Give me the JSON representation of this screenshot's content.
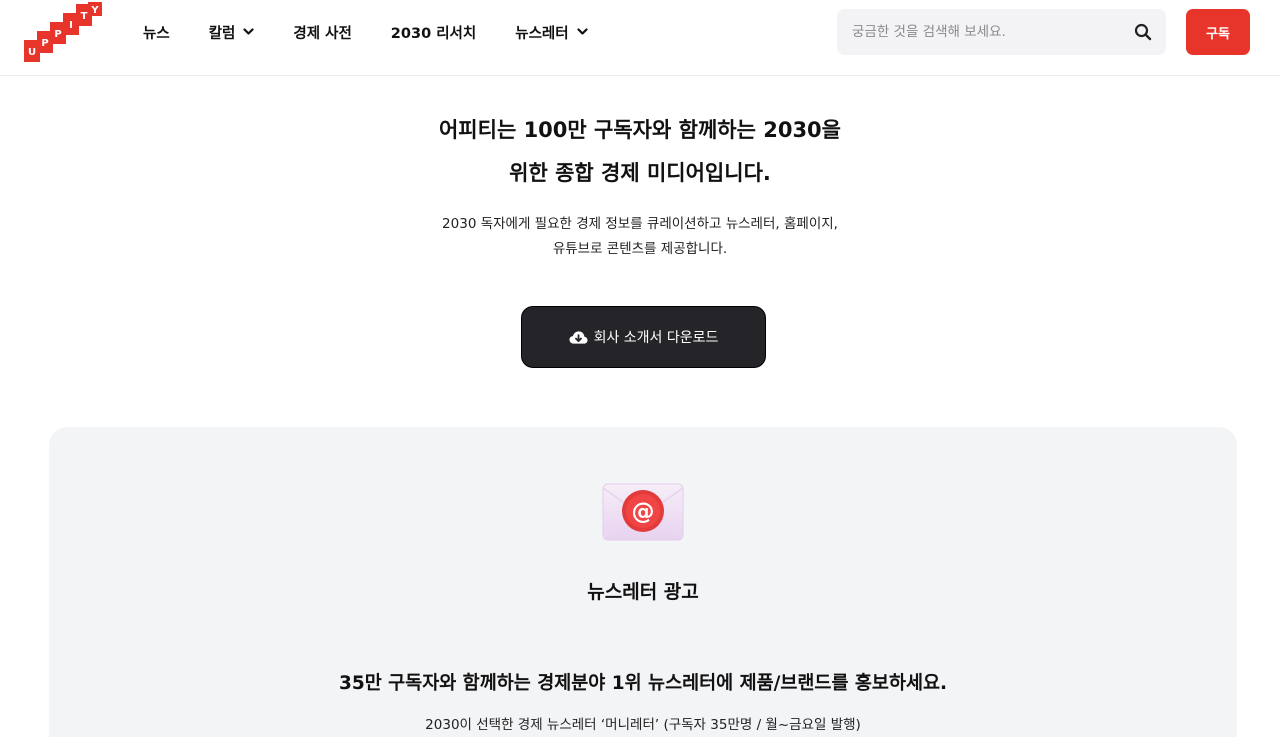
{
  "logo": {
    "text": "UPPITY",
    "letters": [
      "U",
      "P",
      "P",
      "I",
      "T",
      "Y"
    ]
  },
  "nav": {
    "items": [
      {
        "label": "뉴스",
        "has_dropdown": false
      },
      {
        "label": "칼럼",
        "has_dropdown": true
      },
      {
        "label": "경제 사전",
        "has_dropdown": false
      },
      {
        "label": "2030 리서치",
        "has_dropdown": false
      },
      {
        "label": "뉴스레터",
        "has_dropdown": true
      }
    ]
  },
  "search": {
    "placeholder": "궁금한 것을 검색해 보세요.",
    "value": "",
    "icon": "search-icon"
  },
  "header": {
    "subscribe_label": "구독"
  },
  "hero": {
    "title_line1": "어피티는 100만 구독자와 함께하는 2030을",
    "title_line2": "위한 종합 경제 미디어입니다.",
    "desc_line1": "2030 독자에게 필요한 경제 정보를 큐레이션하고 뉴스레터, 홈페이지,",
    "desc_line2": "유튜브로 콘텐츠를 제공합니다.",
    "download_label": "회사 소개서 다운로드",
    "download_icon": "cloud-download-icon"
  },
  "newsletter_ad": {
    "icon": "mail-at-icon",
    "title": "뉴스레터 광고",
    "headline": "35만 구독자와 함께하는 경제분야 1위 뉴스레터에 제품/브랜드를 홍보하세요.",
    "subtext": "2030이 선택한 경제 뉴스레터 ‘머니레터’ (구독자 35만명 / 월~금요일 발행)"
  },
  "colors": {
    "brand_red": "#e8352b",
    "dark_button": "#252429",
    "card_bg": "#f3f4f6",
    "search_bg": "#f3f3f5"
  }
}
